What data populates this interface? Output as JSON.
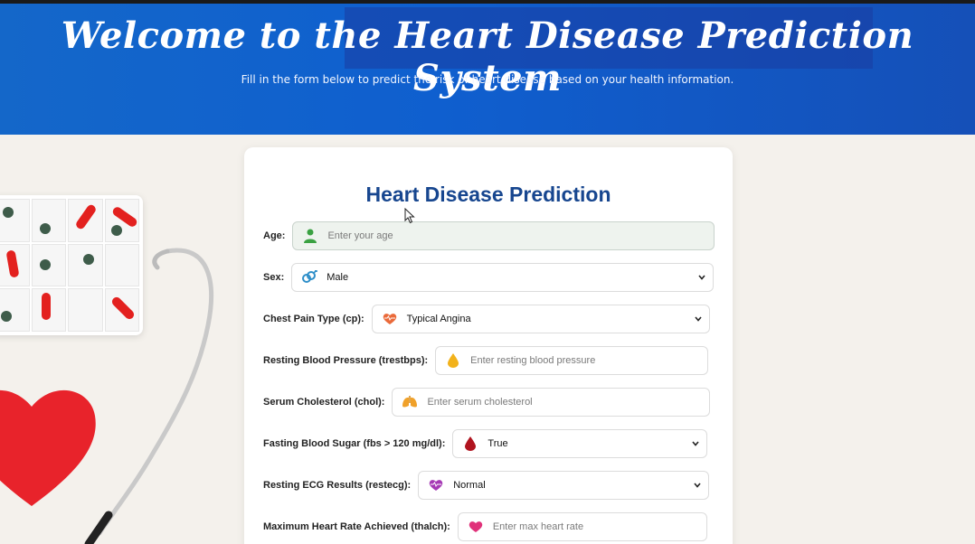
{
  "header": {
    "title": "Welcome to the Heart Disease Prediction System",
    "subtitle": "Fill in the form below to predict the risk of heart disease based on your health information."
  },
  "form": {
    "title": "Heart Disease Prediction",
    "fields": [
      {
        "label": "Age:",
        "placeholder": "Enter your age",
        "icon": "person-icon"
      },
      {
        "label": "Sex:",
        "value": "Male",
        "icon": "gender-icon"
      },
      {
        "label": "Chest Pain Type (cp):",
        "value": "Typical Angina",
        "icon": "heartbeat-icon"
      },
      {
        "label": "Resting Blood Pressure (trestbps):",
        "placeholder": "Enter resting blood pressure",
        "icon": "drop-icon"
      },
      {
        "label": "Serum Cholesterol (chol):",
        "placeholder": "Enter serum cholesterol",
        "icon": "lungs-icon"
      },
      {
        "label": "Fasting Blood Sugar (fbs > 120 mg/dl):",
        "value": "True",
        "icon": "blood-drop-icon"
      },
      {
        "label": "Resting ECG Results (restecg):",
        "value": "Normal",
        "icon": "heart-pulse-icon"
      },
      {
        "label": "Maximum Heart Rate Achieved (thalch):",
        "placeholder": "Enter max heart rate",
        "icon": "heart-icon"
      }
    ]
  },
  "colors": {
    "header_blue": "#1467c9",
    "title_blue": "#17468f"
  }
}
